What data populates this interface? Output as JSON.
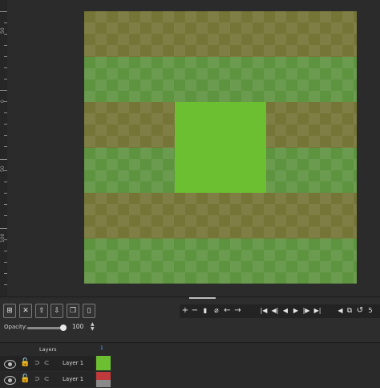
{
  "ruler": {
    "labels": [
      "50",
      "0",
      "50",
      "100"
    ]
  },
  "canvas": {
    "band_colors": [
      "#757537",
      "#5e9340"
    ],
    "square_color": "#6cbf31"
  },
  "toolbar": {
    "left_icons": [
      "add-layer-icon",
      "delete-layer-icon",
      "move-up-icon",
      "move-down-icon",
      "duplicate-icon",
      "phone-icon"
    ],
    "edit_controls": [
      "+",
      "−",
      "▮",
      "⌀",
      "←",
      "→"
    ],
    "playback_controls": [
      "|◀",
      "◀|",
      "◀",
      "▶",
      "|▶",
      "▶|"
    ],
    "extra_controls": [
      "◀",
      "⧉",
      "↺",
      "5"
    ]
  },
  "opacity": {
    "label": "Opacity:",
    "value": "100",
    "level": 1.0
  },
  "layers": {
    "title": "Layers",
    "frame_number": "1",
    "rows": [
      {
        "name": "Layer 1",
        "cel_color": "#6cbf31"
      },
      {
        "name": "Layer 1",
        "cel_color": "#c0393b"
      }
    ]
  }
}
